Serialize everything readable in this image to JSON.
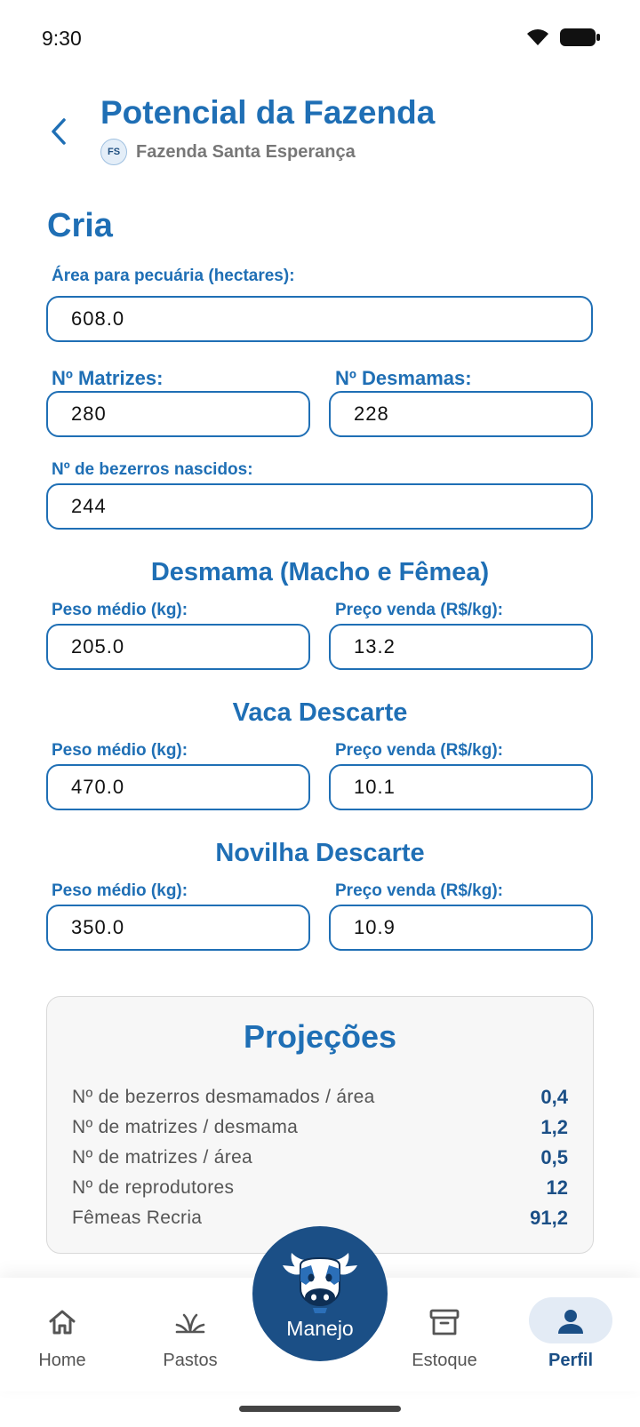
{
  "status_bar": {
    "time": "9:30"
  },
  "header": {
    "title": "Potencial da Fazenda",
    "farm_initials": "FS",
    "farm_name": "Fazenda Santa Esperança"
  },
  "section_title": "Cria",
  "fields": {
    "area": {
      "label": "Área para pecuária (hectares):",
      "value": "608.0"
    },
    "matrizes": {
      "label": "Nº Matrizes:",
      "value": "280"
    },
    "desmamas": {
      "label": "Nº Desmamas:",
      "value": "228"
    },
    "bezerros": {
      "label": "Nº de bezerros nascidos:",
      "value": "244"
    }
  },
  "groups": [
    {
      "title": "Desmama (Macho e Fêmea)",
      "peso_label": "Peso médio (kg):",
      "peso_value": "205.0",
      "preco_label": "Preço venda (R$/kg):",
      "preco_value": "13.2"
    },
    {
      "title": "Vaca Descarte",
      "peso_label": "Peso médio (kg):",
      "peso_value": "470.0",
      "preco_label": "Preço venda (R$/kg):",
      "preco_value": "10.1"
    },
    {
      "title": "Novilha Descarte",
      "peso_label": "Peso médio (kg):",
      "peso_value": "350.0",
      "preco_label": "Preço venda (R$/kg):",
      "preco_value": "10.9"
    }
  ],
  "projections": {
    "title": "Projeções",
    "rows": [
      {
        "label": "Nº de bezerros desmamados / área",
        "value": "0,4"
      },
      {
        "label": "Nº de matrizes / desmama",
        "value": "1,2"
      },
      {
        "label": "Nº de matrizes / área",
        "value": "0,5"
      },
      {
        "label": "Nº de reprodutores",
        "value": "12"
      },
      {
        "label": "Fêmeas Recria",
        "value": "91,2"
      }
    ]
  },
  "bottom_nav": {
    "items": [
      {
        "label": "Home",
        "icon": "home-icon"
      },
      {
        "label": "Pastos",
        "icon": "grass-icon"
      },
      {
        "label": "Estoque",
        "icon": "archive-icon"
      },
      {
        "label": "Perfil",
        "icon": "person-icon",
        "active": true
      }
    ],
    "center": {
      "label": "Manejo",
      "icon": "cow-icon"
    }
  },
  "colors": {
    "primary": "#1f6fb5",
    "nav_dark": "#1b4f86",
    "card_bg": "#f7f7f7"
  }
}
